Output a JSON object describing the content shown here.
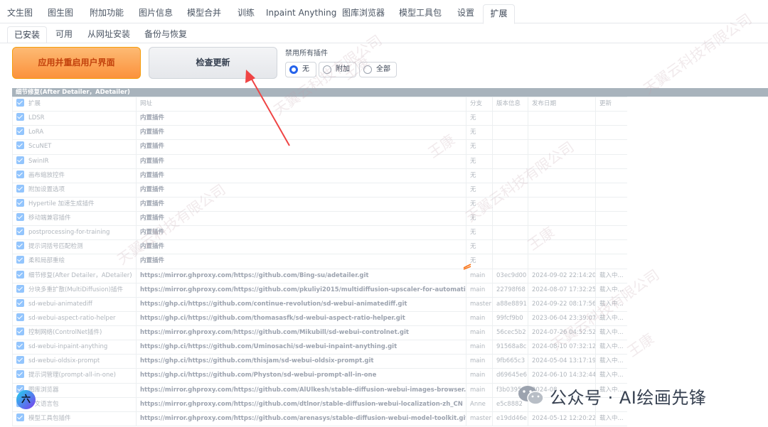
{
  "top_tabs": [
    "文生图",
    "图生图",
    "附加功能",
    "图片信息",
    "模型合并",
    "训练",
    "Inpaint Anything",
    "图库浏览器",
    "模型工具包",
    "设置",
    "扩展"
  ],
  "sub_tabs": [
    "已安装",
    "可用",
    "从网址安装",
    "备份与恢复"
  ],
  "buttons": {
    "apply": "应用并重启用户界面",
    "check": "检查更新"
  },
  "disable_all": {
    "label": "禁用所有插件",
    "options": [
      "无",
      "附加",
      "全部"
    ],
    "selected": "无"
  },
  "band_title": "细节修复(After Detailer，ADetailer)",
  "table": {
    "headers": [
      "扩展",
      "网址",
      "分支",
      "版本信息",
      "发布日期",
      "更新"
    ],
    "rows": [
      [
        "LDSR",
        "内置插件",
        "无",
        "",
        "",
        ""
      ],
      [
        "LoRA",
        "内置插件",
        "无",
        "",
        "",
        ""
      ],
      [
        "ScuNET",
        "内置插件",
        "无",
        "",
        "",
        ""
      ],
      [
        "SwinIR",
        "内置插件",
        "无",
        "",
        "",
        ""
      ],
      [
        "画布缩放控件",
        "内置插件",
        "无",
        "",
        "",
        ""
      ],
      [
        "附加设置选项",
        "内置插件",
        "无",
        "",
        "",
        ""
      ],
      [
        "Hypertile 加速生成插件",
        "内置插件",
        "无",
        "",
        "",
        ""
      ],
      [
        "移动端兼容插件",
        "内置插件",
        "无",
        "",
        "",
        ""
      ],
      [
        "postprocessing-for-training",
        "内置插件",
        "无",
        "",
        "",
        ""
      ],
      [
        "提示词括号匹配检测",
        "内置插件",
        "无",
        "",
        "",
        ""
      ],
      [
        "柔和局部重绘",
        "内置插件",
        "无",
        "",
        "",
        ""
      ],
      [
        "细节修复(After Detailer，ADetailer)",
        "https://mirror.ghproxy.com/https://github.com/Bing-su/adetailer.git",
        "main",
        "03ec9d00",
        "2024-09-02 22:14:20",
        "载入中..."
      ],
      [
        "分块多重扩散(MultiDiffusion)插件",
        "https://mirror.ghproxy.com/https://github.com/pkuliyi2015/multidiffusion-upscaler-for-automatic1111.git",
        "main",
        "22798f68",
        "2024-08-07 17:32:25",
        "载入中..."
      ],
      [
        "sd-webui-animatediff",
        "https://ghp.ci/https://github.com/continue-revolution/sd-webui-animatediff.git",
        "master",
        "a88e8891",
        "2024-09-22 08:17:56",
        "载入中..."
      ],
      [
        "sd-webui-aspect-ratio-helper",
        "https://ghp.ci/https://github.com/thomasasfk/sd-webui-aspect-ratio-helper.git",
        "main",
        "99fcf9b0",
        "2023-06-04 23:39:07",
        "载入中..."
      ],
      [
        "控制网络(ControlNet插件)",
        "https://mirror.ghproxy.com/https://github.com/Mikubill/sd-webui-controlnet.git",
        "main",
        "56cec5b2",
        "2024-07-26 04:52:52",
        "载入中..."
      ],
      [
        "sd-webui-inpaint-anything",
        "https://ghp.ci/https://github.com/Uminosachi/sd-webui-inpaint-anything.git",
        "main",
        "91568a8c",
        "2024-08-10 07:32:12",
        "载入中..."
      ],
      [
        "sd-webui-oldsix-prompt",
        "https://ghp.ci/https://github.com/thisjam/sd-webui-oldsix-prompt.git",
        "main",
        "9fb665c3",
        "2024-05-04 13:17:19",
        "载入中..."
      ],
      [
        "提示词管理(prompt-all-in-one)",
        "https://ghp.ci/https://github.com/Physton/sd-webui-prompt-all-in-one",
        "main",
        "d69645e6",
        "2024-06-10 14:32:44",
        "载入中..."
      ],
      [
        "图库浏览器",
        "https://mirror.ghproxy.com/https://github.com/AlUlkesh/stable-diffusion-webui-images-browser.git",
        "main",
        "f3b0395",
        "2024-08",
        "载入中..."
      ],
      [
        "中文语言包",
        "https://mirror.ghproxy.com/https://github.com/dtlnor/stable-diffusion-webui-localization-zh_CN",
        "Anne",
        "e5c8882",
        "",
        ""
      ],
      [
        "模型工具包插件",
        "https://mirror.ghproxy.com/https://github.com/arenasys/stable-diffusion-webui-model-toolkit.git",
        "master",
        "e19dd46e",
        "2024-05-12 12:20:22",
        "载入中..."
      ]
    ]
  },
  "watermark_texts": [
    "天翼云科技有限公司",
    "王康"
  ],
  "badge": "六",
  "brand": "公众号 · AI绘画先锋",
  "colors": {
    "accent_orange": "#fb923c",
    "radio_selected": "#2563eb",
    "arrow": "#ef4444",
    "checkbox": "#93c5fd"
  }
}
